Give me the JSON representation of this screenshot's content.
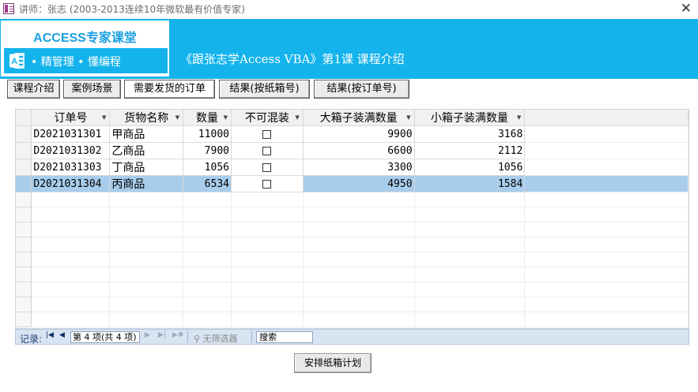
{
  "window": {
    "title": "讲师：张志 (2003-2013连续10年微软最有价值专家)",
    "close_glyph": "✕"
  },
  "header": {
    "logo_title": "ACCESS专家课堂",
    "logo_tagline": "• 精管理 • 懂编程",
    "course_title": "《跟张志学Access VBA》第1课 课程介绍",
    "colors": {
      "band": "#14b3ec",
      "logo_title": "#1b9fe0"
    }
  },
  "tabs": [
    {
      "label": "课程介绍"
    },
    {
      "label": "案例场景"
    },
    {
      "label": "需要发货的订单"
    },
    {
      "label": "结果(按纸箱号)"
    },
    {
      "label": "结果(按订单号)"
    }
  ],
  "grid": {
    "columns": [
      "订单号",
      "货物名称",
      "数量",
      "不可混装",
      "大箱子装满数量",
      "小箱子装满数量"
    ],
    "rows": [
      {
        "order_no": "D2021031301",
        "goods": "甲商品",
        "qty": "11000",
        "no_mix": false,
        "big_box": "9900",
        "small_box": "3168"
      },
      {
        "order_no": "D2021031302",
        "goods": "乙商品",
        "qty": "7900",
        "no_mix": false,
        "big_box": "6600",
        "small_box": "2112"
      },
      {
        "order_no": "D2021031303",
        "goods": "丁商品",
        "qty": "1056",
        "no_mix": false,
        "big_box": "3300",
        "small_box": "1056"
      },
      {
        "order_no": "D2021031304",
        "goods": "丙商品",
        "qty": "6534",
        "no_mix": false,
        "big_box": "4950",
        "small_box": "1584"
      }
    ],
    "current_row_color": "#a8cdec"
  },
  "navigator": {
    "label": "记录:",
    "position": "第 4 项(共 4 项)",
    "filter": "无筛选器",
    "search": "搜索"
  },
  "action_button": {
    "label": "安排纸箱计划"
  }
}
